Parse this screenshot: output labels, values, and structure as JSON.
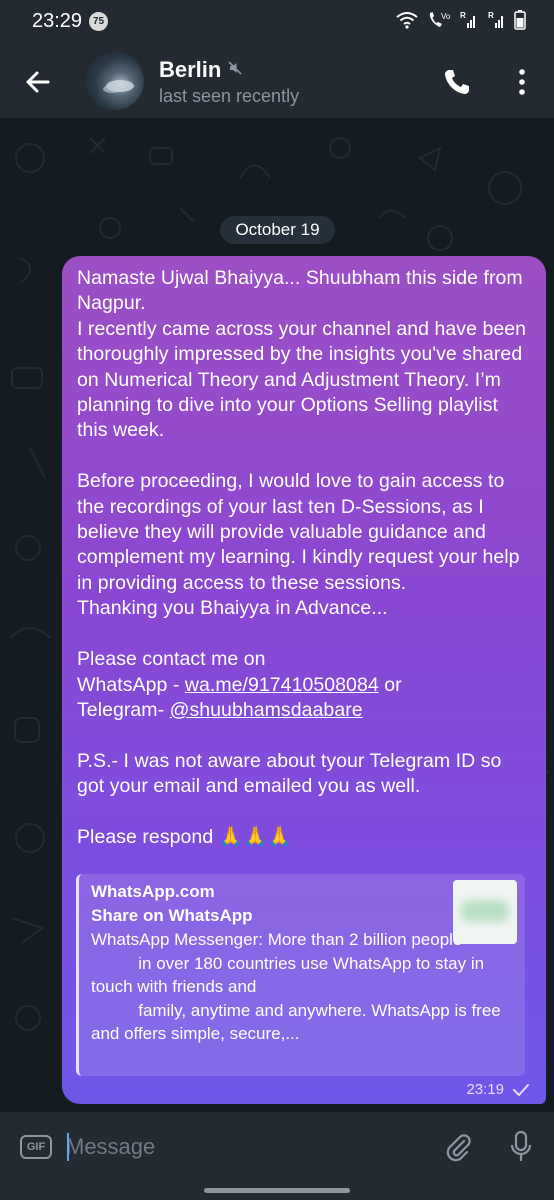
{
  "status_bar": {
    "time": "23:29",
    "notification_count": "75",
    "icons": [
      "wifi-icon",
      "volte-call-icon",
      "signal-r-icon",
      "signal-r-icon",
      "battery-icon"
    ]
  },
  "header": {
    "back_icon": "arrow-left-icon",
    "title": "Berlin",
    "muted_icon": "mute-icon",
    "subtitle": "last seen recently",
    "actions": [
      "phone-icon",
      "more-vertical-icon"
    ]
  },
  "chat": {
    "date_label": "October 19",
    "message": {
      "p1": "Namaste Ujwal Bhaiyya... Shuubham this side from Nagpur.\nI recently came across your channel and have been thoroughly impressed by the insights you've shared on Numerical Theory and Adjustment Theory. I’m planning to dive into your Options Selling playlist this week.\n\nBefore proceeding, I would love to gain access to the recordings of your last ten D-Sessions, as I believe they will provide valuable guidance and complement my learning. I kindly request your help in providing access to these sessions.\nThanking you Bhaiyya in Advance...\n\nPlease contact me on\nWhatsApp - ",
      "whatsapp_link": "wa.me/917410508084",
      "or": " or\nTelegram- ",
      "telegram_link": "@shuubhamsdaabare",
      "p2": "\n\nP.S.- I was not aware about tyour Telegram ID so got your email and emailed you as well.\n\nPlease respond 🙏🙏🙏",
      "time": "23:19",
      "status_icon": "check-icon"
    },
    "link_preview": {
      "site": "WhatsApp.com",
      "title": "Share on WhatsApp",
      "description": "WhatsApp Messenger: More than 2 billion people\n          in over 180 countries use WhatsApp to stay in touch with friends and\n          family, anytime and anywhere. WhatsApp is free and offers simple, secure,..."
    }
  },
  "input_bar": {
    "gif_label": "GIF",
    "placeholder": "Message",
    "icons": [
      "paperclip-icon",
      "microphone-icon"
    ]
  },
  "colors": {
    "bubble_top": "#9c4fc4",
    "bubble_bottom": "#6f57e8",
    "header_bg": "#232a31",
    "chat_bg": "#141b21"
  }
}
